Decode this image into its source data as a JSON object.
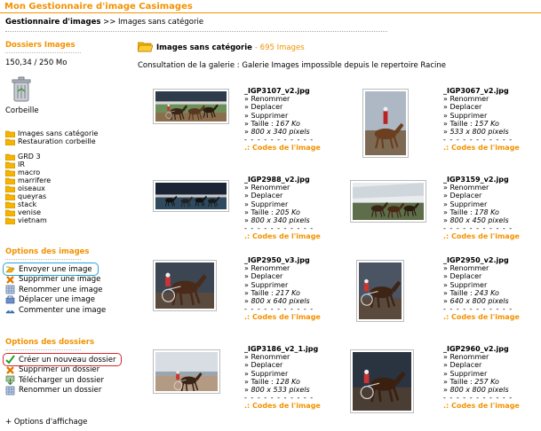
{
  "app_title": "Mon Gestionnaire d'image Casimages",
  "breadcrumb": {
    "root": "Gestionnaire d'images",
    "sep": ">>",
    "current": "Images sans catégorie"
  },
  "sidebar": {
    "folders_heading": "Dossiers Images",
    "quota": "150,34 / 250 Mo",
    "trash_label": "Corbeille",
    "special": [
      "Images sans catégorie",
      "Restauration corbeille"
    ],
    "folders": [
      "GRD 3",
      "IR",
      "macro",
      "marrifere",
      "oiseaux",
      "queyras",
      "stack",
      "venise",
      "vietnam"
    ],
    "image_options_heading": "Options des images",
    "image_options": [
      "Envoyer une image",
      "Supprimer une image",
      "Renommer une image",
      "Déplacer une image",
      "Commenter une image"
    ],
    "folder_options_heading": "Options des dossiers",
    "folder_options": [
      "Créer un nouveau dossier",
      "Supprimer un dossier",
      "Télécharger un dossier",
      "Renommer un dossier"
    ],
    "display_options": "+ Options d'affichage"
  },
  "main": {
    "title": "Images sans catégorie",
    "count": "- 695 Images",
    "notice": "Consultation de la galerie : Galerie Images impossible depuis le repertoire Racine",
    "labels": {
      "rename": "» Renommer",
      "move": "» Deplacer",
      "delete": "» Supprimer",
      "size_prefix": "» Taille : ",
      "dims_prefix": "» ",
      "dashes": "- - - - - - - - - - -",
      "codes": ".: Codes de l'image"
    },
    "images": [
      {
        "name": "_IGP3107_v2.jpg",
        "size": "167 Ko",
        "dims": "800 x 340 pixels"
      },
      {
        "name": "_IGP3067_v2.jpg",
        "size": "157 Ko",
        "dims": "533 x 800 pixels"
      },
      {
        "name": "_IGP2988_v2.jpg",
        "size": "205 Ko",
        "dims": "800 x 340 pixels"
      },
      {
        "name": "_IGP3159_v2.jpg",
        "size": "178 Ko",
        "dims": "800 x 450 pixels"
      },
      {
        "name": "_IGP2950_v3.jpg",
        "size": "217 Ko",
        "dims": "800 x 640 pixels"
      },
      {
        "name": "_IGP2950_v2.jpg",
        "size": "243 Ko",
        "dims": "640 x 800 pixels"
      },
      {
        "name": "_IGP3186_v2_1.jpg",
        "size": "128 Ko",
        "dims": "800 x 533 pixels"
      },
      {
        "name": "_IGP2960_v2.jpg",
        "size": "257 Ko",
        "dims": "800 x 800 pixels"
      }
    ]
  },
  "colors": {
    "accent": "#f39200",
    "highlight_blue": "#29a3d9",
    "highlight_red": "#d9262c",
    "folder": "#f5b400"
  }
}
